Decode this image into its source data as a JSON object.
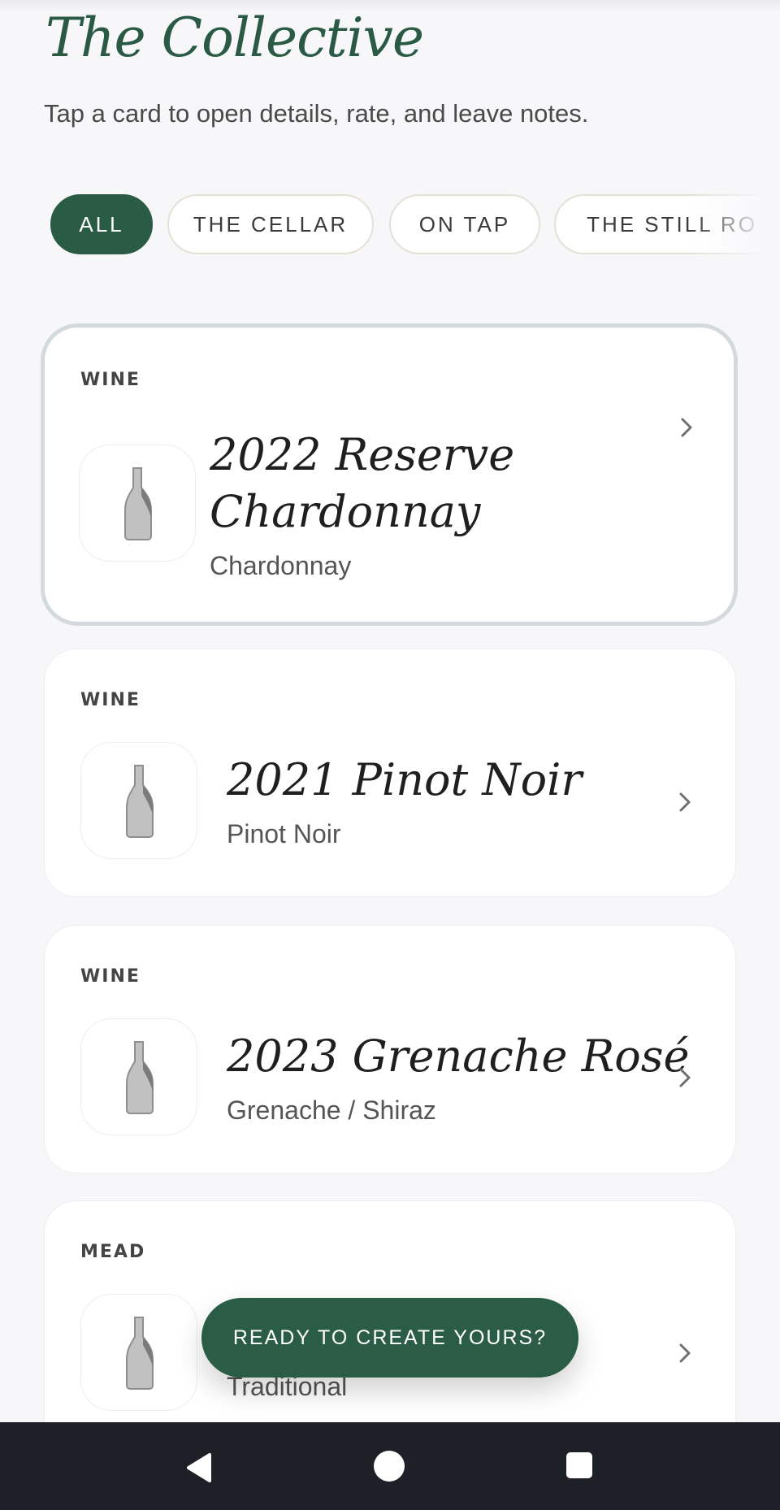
{
  "header": {
    "title": "The Collective",
    "subtitle": "Tap a card to open details, rate, and leave notes."
  },
  "filters": [
    {
      "label": "ALL",
      "active": true
    },
    {
      "label": "THE CELLAR",
      "active": false
    },
    {
      "label": "ON TAP",
      "active": false
    },
    {
      "label": "THE STILL RO",
      "active": false
    }
  ],
  "cards": [
    {
      "kind": "WINE",
      "name_line1": "2022 Reserve",
      "name_line2": "Chardonnay",
      "variety": "Chardonnay",
      "selected": true,
      "icon": "wine-bottle-icon"
    },
    {
      "kind": "WINE",
      "name": "2021 Pinot Noir",
      "variety": "Pinot Noir",
      "icon": "wine-bottle-icon"
    },
    {
      "kind": "WINE",
      "name": "2023 Grenache Rosé",
      "variety": "Grenache / Shiraz",
      "icon": "wine-bottle-icon"
    },
    {
      "kind": "MEAD",
      "name": "",
      "variety": "Traditional",
      "icon": "wine-bottle-icon"
    }
  ],
  "cta": {
    "label": "READY TO CREATE YOURS?"
  },
  "navigation": {
    "back_icon": "back-triangle-icon",
    "home_icon": "home-circle-icon",
    "recents_icon": "recents-square-icon"
  },
  "colors": {
    "accent": "#2a5c45",
    "background": "#f7f6f9",
    "navbar": "#1d2026"
  }
}
